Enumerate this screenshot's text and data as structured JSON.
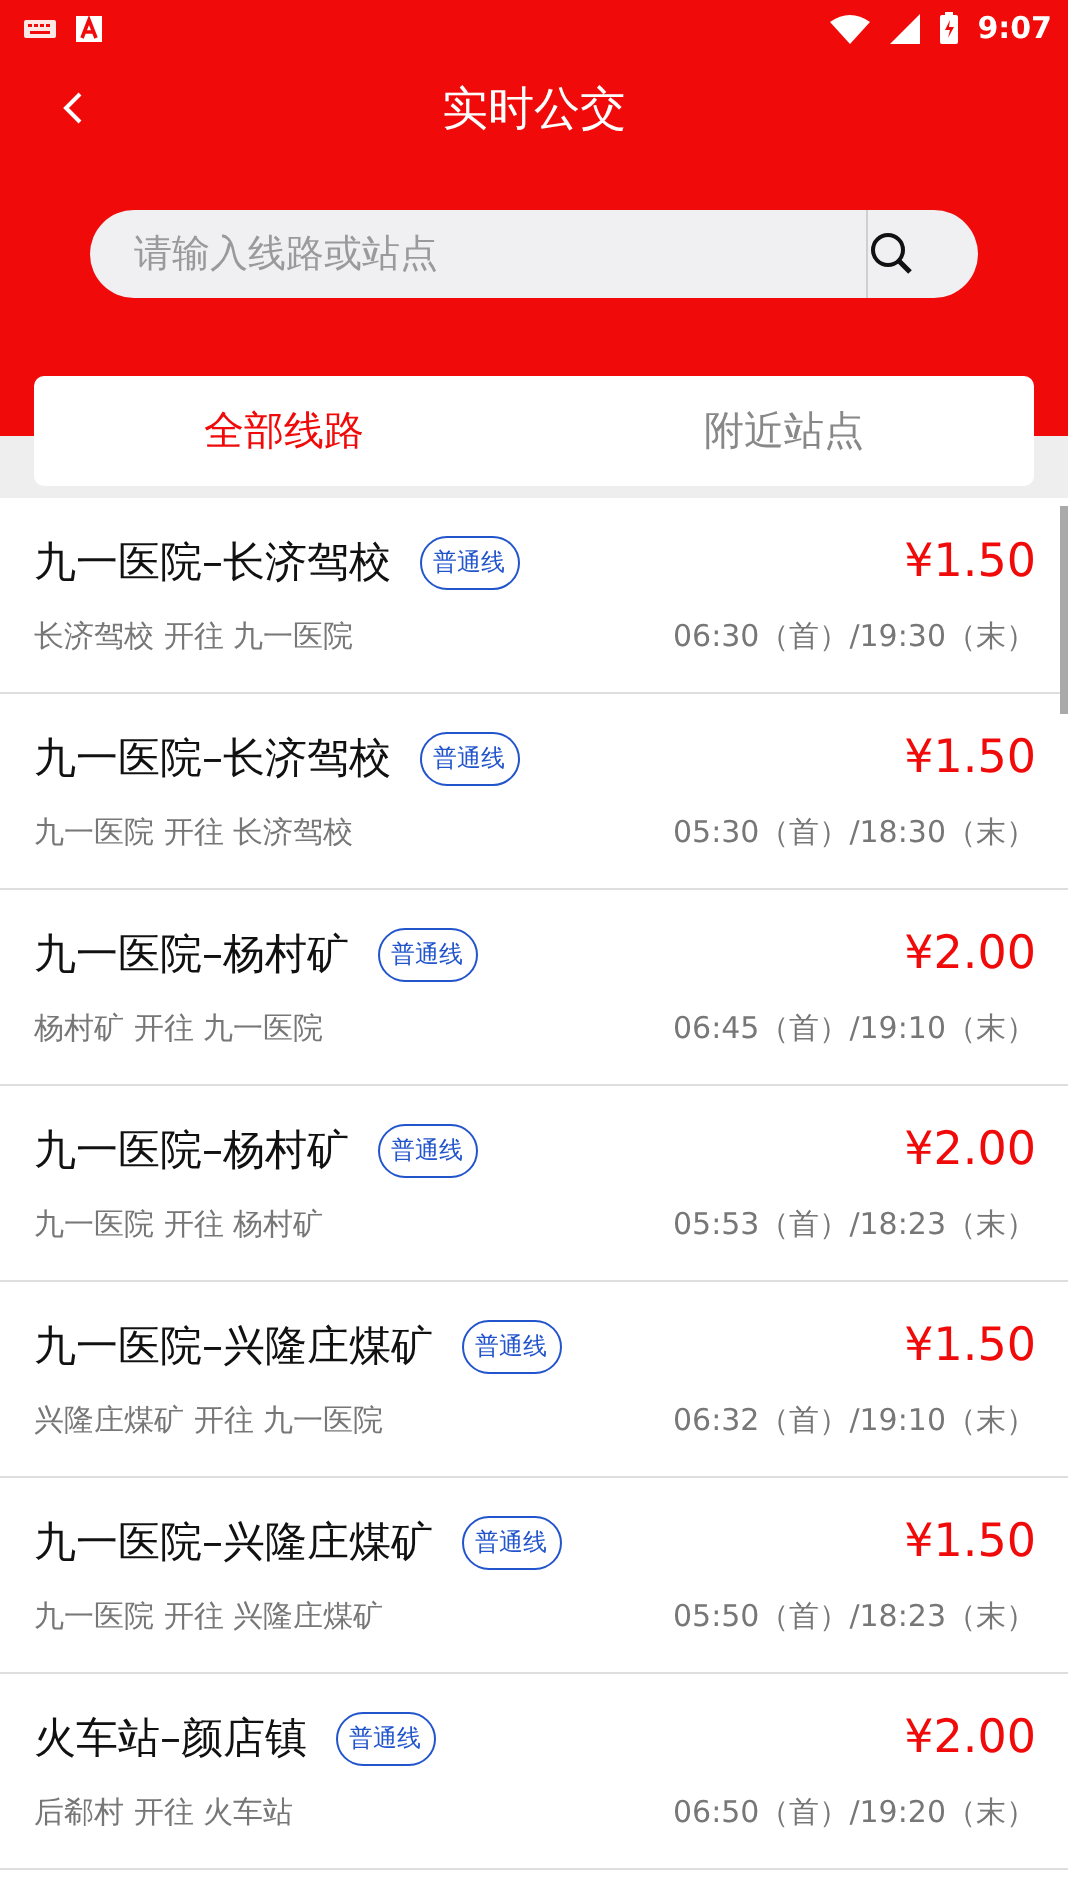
{
  "status_bar": {
    "time": "9:07"
  },
  "header": {
    "title": "实时公交"
  },
  "search": {
    "placeholder": "请输入线路或站点"
  },
  "tabs": [
    {
      "label": "全部线路",
      "selected": true
    },
    {
      "label": "附近站点",
      "selected": false
    }
  ],
  "routes": [
    {
      "name": "九一医院–长济驾校",
      "tag": "普通线",
      "price": "¥1.50",
      "direction": "长济驾校 开往 九一医院",
      "hours": "06:30（首）/19:30（末）"
    },
    {
      "name": "九一医院–长济驾校",
      "tag": "普通线",
      "price": "¥1.50",
      "direction": "九一医院 开往 长济驾校",
      "hours": "05:30（首）/18:30（末）"
    },
    {
      "name": "九一医院–杨村矿",
      "tag": "普通线",
      "price": "¥2.00",
      "direction": "杨村矿 开往 九一医院",
      "hours": "06:45（首）/19:10（末）"
    },
    {
      "name": "九一医院–杨村矿",
      "tag": "普通线",
      "price": "¥2.00",
      "direction": "九一医院 开往 杨村矿",
      "hours": "05:53（首）/18:23（末）"
    },
    {
      "name": "九一医院–兴隆庄煤矿",
      "tag": "普通线",
      "price": "¥1.50",
      "direction": "兴隆庄煤矿 开往 九一医院",
      "hours": "06:32（首）/19:10（末）"
    },
    {
      "name": "九一医院–兴隆庄煤矿",
      "tag": "普通线",
      "price": "¥1.50",
      "direction": "九一医院 开往 兴隆庄煤矿",
      "hours": "05:50（首）/18:23（末）"
    },
    {
      "name": "火车站–颜店镇",
      "tag": "普通线",
      "price": "¥2.00",
      "direction": "后郗村 开往 火车站",
      "hours": "06:50（首）/19:20（末）"
    }
  ]
}
